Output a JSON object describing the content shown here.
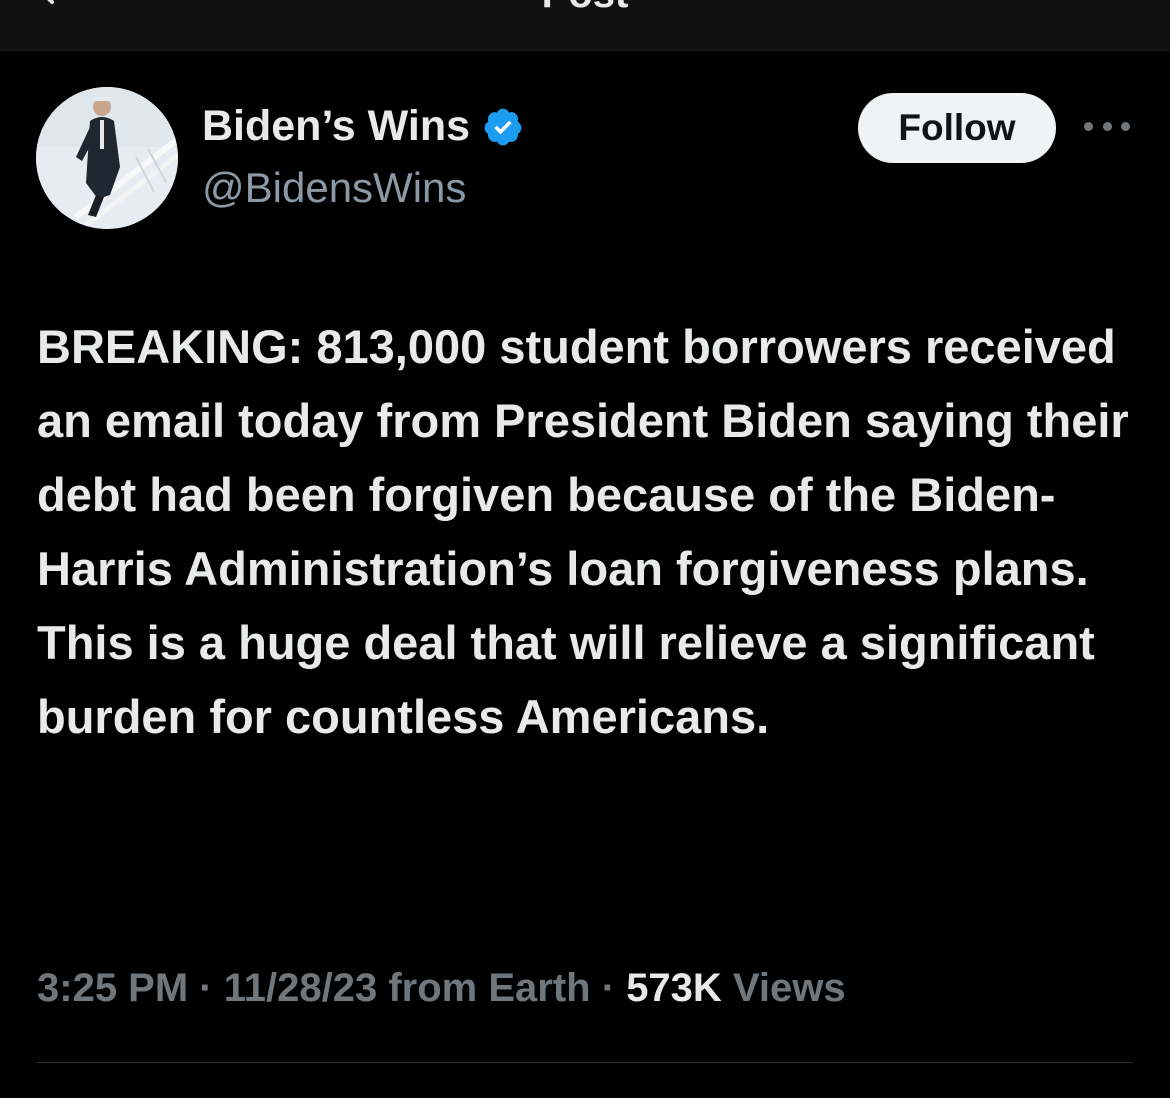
{
  "header": {
    "title": "Post"
  },
  "author": {
    "display_name": "Biden’s Wins",
    "handle": "@BidensWins",
    "verified": true,
    "verified_color": "#1d9bf0",
    "avatar_icon": "profile-photo"
  },
  "actions": {
    "follow_label": "Follow",
    "more_icon": "more-horizontal-icon"
  },
  "post": {
    "text": "BREAKING: 813,000 student borrowers received an email today from President Biden saying their debt had been forgiven because of the Biden-Harris Administration’s loan forgiveness plans. This is a huge deal that will relieve a significant burden for countless Americans."
  },
  "meta": {
    "time": "3:25 PM",
    "date": "11/28/23 from Earth",
    "separator": "·",
    "views_count": "573K",
    "views_label": "Views"
  }
}
